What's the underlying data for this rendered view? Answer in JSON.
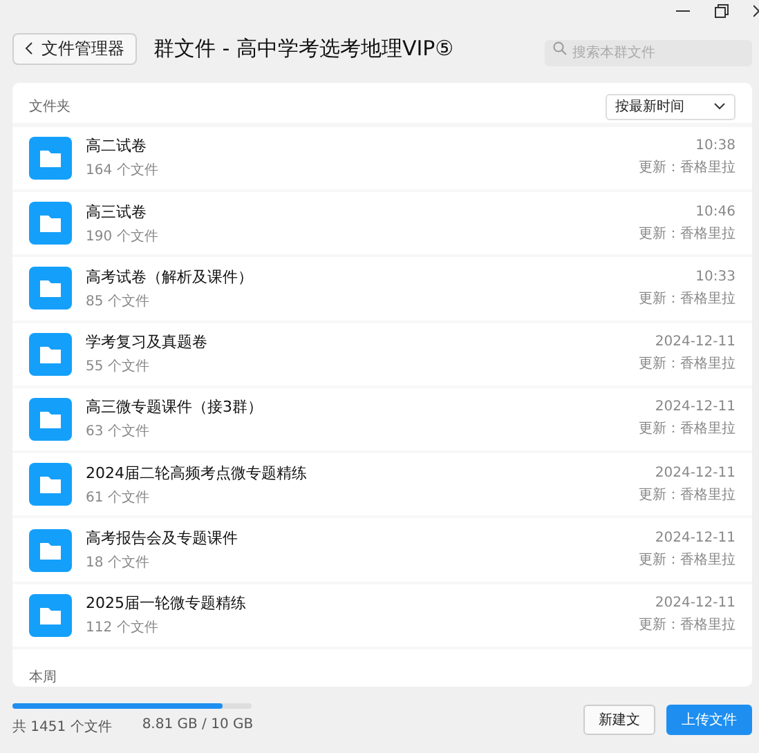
{
  "header": {
    "back_label": "文件管理器",
    "title": "群文件 - 高中学考选考地理VIP⑤",
    "search": {
      "placeholder": "搜索本群文件"
    }
  },
  "section_label": "文件夹",
  "sort": {
    "value": "按最新时间"
  },
  "folders": [
    {
      "name": "高二试卷",
      "count": "164 个文件",
      "time": "10:38",
      "updater": "更新：香格里拉"
    },
    {
      "name": "高三试卷",
      "count": "190 个文件",
      "time": "10:46",
      "updater": "更新：香格里拉"
    },
    {
      "name": "高考试卷（解析及课件）",
      "count": "85 个文件",
      "time": "10:33",
      "updater": "更新：香格里拉"
    },
    {
      "name": "学考复习及真题卷",
      "count": "55 个文件",
      "time": "2024-12-11",
      "updater": "更新：香格里拉"
    },
    {
      "name": "高三微专题课件（接3群）",
      "count": "63 个文件",
      "time": "2024-12-11",
      "updater": "更新：香格里拉"
    },
    {
      "name": "2024届二轮高频考点微专题精练",
      "count": "61 个文件",
      "time": "2024-12-11",
      "updater": "更新：香格里拉"
    },
    {
      "name": "高考报告会及专题课件",
      "count": "18 个文件",
      "time": "2024-12-11",
      "updater": "更新：香格里拉"
    },
    {
      "name": "2025届一轮微专题精练",
      "count": "112 个文件",
      "time": "2024-12-11",
      "updater": "更新：香格里拉"
    }
  ],
  "next_section_label": "本周",
  "status_bar": {
    "total": "共 1451 个文件",
    "usage": "8.81 GB / 10 GB",
    "level": 0.88,
    "buttons": [
      {
        "label": "新建文",
        "kind": "secondary"
      },
      {
        "label": "上传文件",
        "kind": "primary"
      }
    ]
  }
}
